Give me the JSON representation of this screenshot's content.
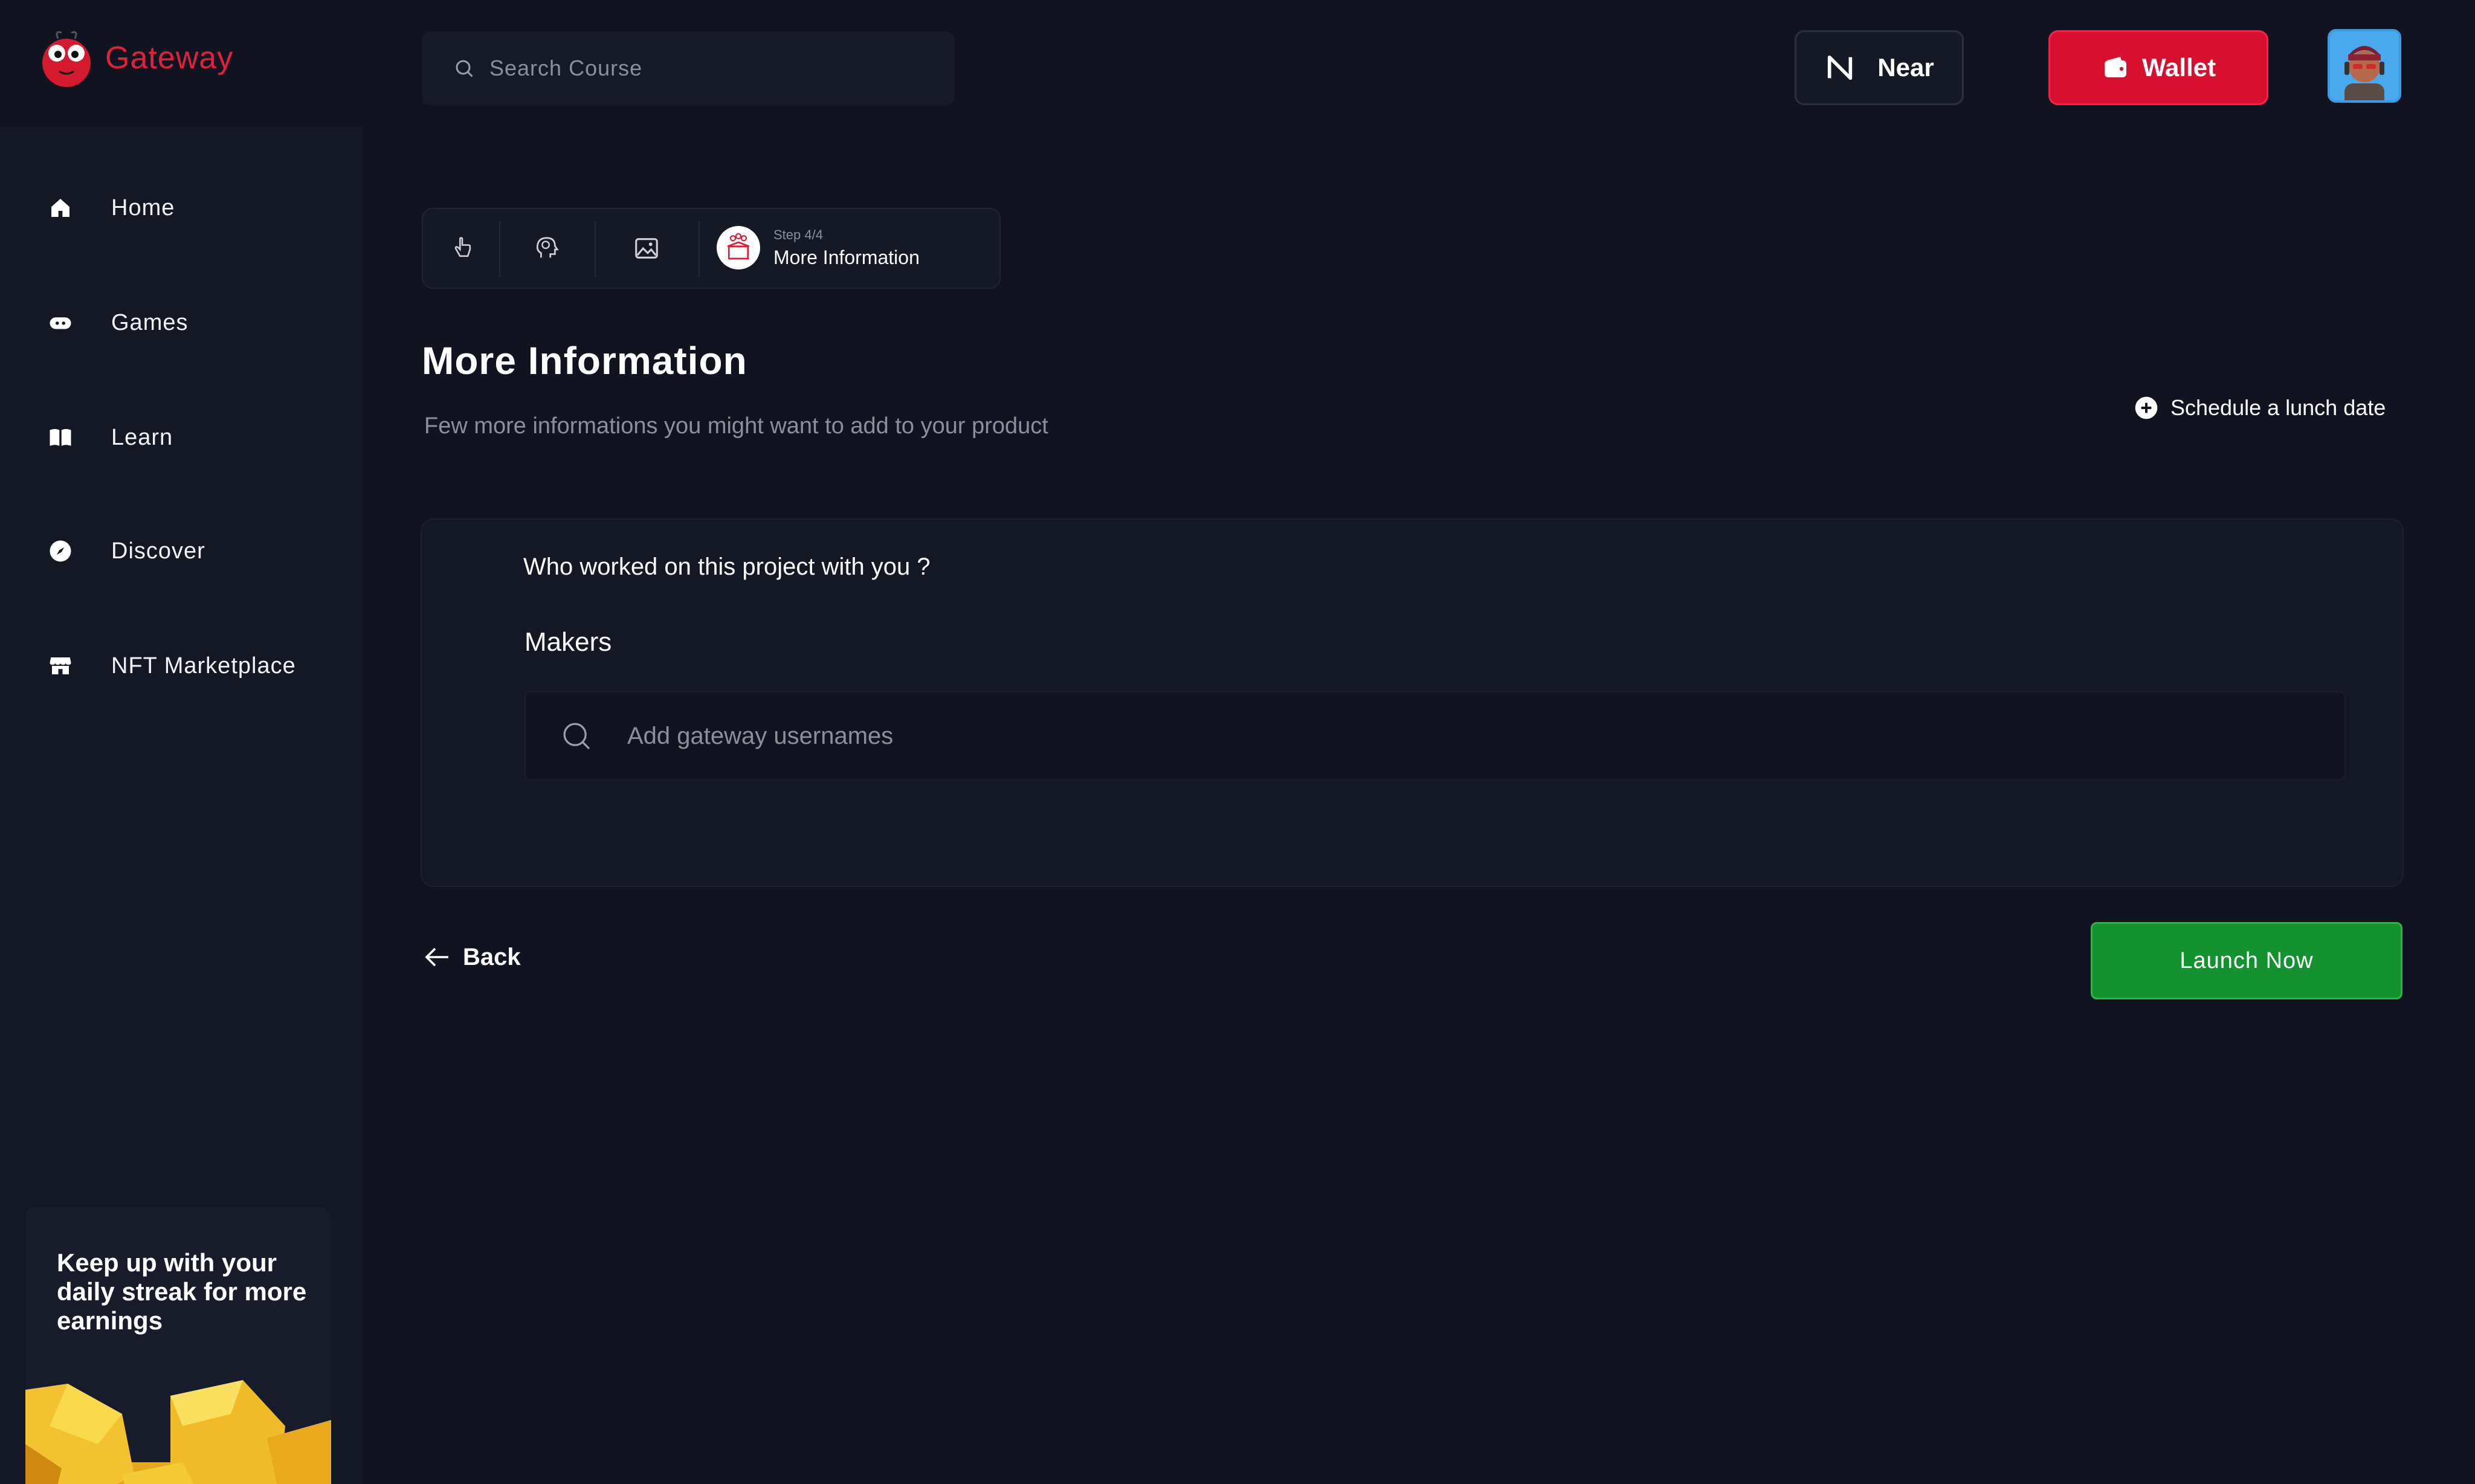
{
  "app": {
    "brand_name": "Gateway",
    "accent_color": "#e0213c"
  },
  "header": {
    "search_placeholder": "Search Course",
    "network_button_label": "Near",
    "wallet_button_label": "Wallet"
  },
  "sidebar": {
    "items": [
      {
        "label": "Home",
        "icon": "home-icon"
      },
      {
        "label": "Games",
        "icon": "gamepad-icon"
      },
      {
        "label": "Learn",
        "icon": "book-icon"
      },
      {
        "label": "Discover",
        "icon": "compass-icon"
      },
      {
        "label": "NFT Marketplace",
        "icon": "store-icon"
      }
    ],
    "promo_text": "Keep up with your daily streak for more earnings"
  },
  "stepper": {
    "steps": [
      {
        "icon": "hand-pointer-icon"
      },
      {
        "icon": "head-brain-icon"
      },
      {
        "icon": "image-icon"
      },
      {
        "icon": "product-box-icon"
      }
    ],
    "step_count": "Step 4/4",
    "active_title": "More Information"
  },
  "main": {
    "title": "More Information",
    "subtitle": "Few more informations you might want to add to your product",
    "schedule_label": "Schedule a lunch date",
    "card": {
      "question": "Who worked on this project with you ?",
      "makers_label": "Makers",
      "usernames_placeholder": "Add gateway usernames"
    },
    "back_label": "Back",
    "launch_label": "Launch Now"
  },
  "colors": {
    "background": "#111420",
    "sidebar": "#141825",
    "wallet_red": "#d8102f",
    "launch_green": "#14922f"
  }
}
